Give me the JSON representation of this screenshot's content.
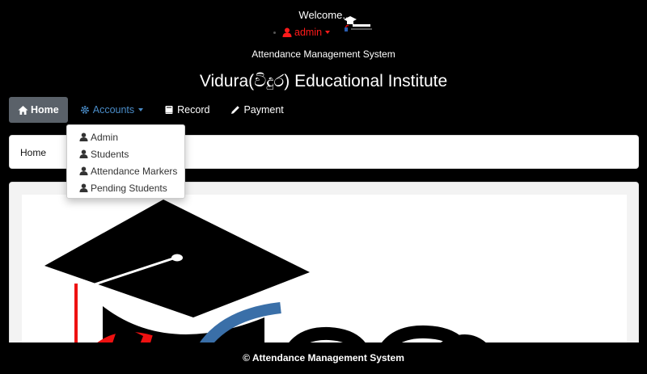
{
  "header": {
    "welcome": "Welcome..",
    "user_label": "admin",
    "system_name": "Attendance Management System",
    "institute_title": "Vidura(විදුර) Educational Institute"
  },
  "nav": {
    "home": "Home",
    "accounts": "Accounts",
    "record": "Record",
    "payment": "Payment"
  },
  "accounts_menu": {
    "items": [
      {
        "label": "Admin",
        "icon": "user-icon"
      },
      {
        "label": "Students",
        "icon": "user-icon"
      },
      {
        "label": "Attendance Markers",
        "icon": "user-icon"
      },
      {
        "label": "Pending Students",
        "icon": "user-icon"
      }
    ]
  },
  "breadcrumb": {
    "current": "Home"
  },
  "footer": {
    "text": "© Attendance Management System"
  },
  "colors": {
    "accent_red": "#ff1a1a",
    "accounts_blue": "#4a8cc8",
    "nav_active": "#5a6169"
  }
}
